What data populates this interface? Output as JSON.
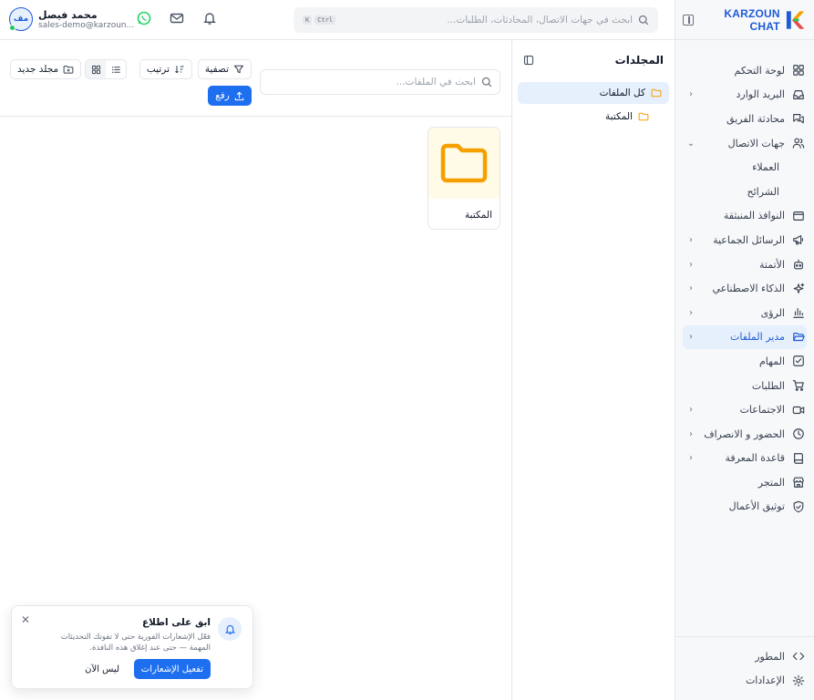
{
  "brand": {
    "name": "KARZOUN CHAT"
  },
  "sidebar": {
    "items": [
      {
        "label": "لوحة التحكم",
        "icon": "dashboard-icon",
        "chevron": false
      },
      {
        "label": "البريد الوارد",
        "icon": "inbox-icon",
        "chevron": true
      },
      {
        "label": "محادثة الفريق",
        "icon": "team-chat-icon",
        "chevron": false
      },
      {
        "label": "جهات الاتصال",
        "icon": "contacts-icon",
        "chevron": true,
        "expanded": true
      },
      {
        "label": "العملاء",
        "sub": true
      },
      {
        "label": "الشرائح",
        "sub": true
      },
      {
        "label": "النوافذ المنبثقة",
        "icon": "popup-icon",
        "chevron": false
      },
      {
        "label": "الرسائل الجماعية",
        "icon": "megaphone-icon",
        "chevron": true
      },
      {
        "label": "الأتمتة",
        "icon": "bot-icon",
        "chevron": true
      },
      {
        "label": "الذكاء الاصطناعي",
        "icon": "sparkles-icon",
        "chevron": true
      },
      {
        "label": "الرؤى",
        "icon": "chart-icon",
        "chevron": true
      },
      {
        "label": "مدير الملفات",
        "icon": "folder-open-icon",
        "chevron": true,
        "active": true
      },
      {
        "label": "المهام",
        "icon": "tasks-icon",
        "chevron": false
      },
      {
        "label": "الطلبات",
        "icon": "cart-icon",
        "chevron": false
      },
      {
        "label": "الاجتماعات",
        "icon": "video-icon",
        "chevron": true
      },
      {
        "label": "الحضور و الانصراف",
        "icon": "clock-icon",
        "chevron": true
      },
      {
        "label": "قاعدة المعرفة",
        "icon": "book-icon",
        "chevron": true
      },
      {
        "label": "المتجر",
        "icon": "store-icon",
        "chevron": false
      },
      {
        "label": "توثيق الأعمال",
        "icon": "shield-check-icon",
        "chevron": false
      }
    ],
    "bottom": [
      {
        "label": "المطور",
        "icon": "code-icon"
      },
      {
        "label": "الإعدادات",
        "icon": "gear-icon"
      }
    ]
  },
  "header": {
    "search_placeholder": "ابحث في جهات الاتصال، المحادثات، الطلبات...",
    "kbd": [
      "Ctrl",
      "K"
    ],
    "user_name": "محمد فيصل",
    "user_email": "sales-demo@karzoun...",
    "avatar_initials": "مف"
  },
  "folders": {
    "title": "المجلدات",
    "items": [
      {
        "label": "كل الملفات",
        "active": true
      },
      {
        "label": "المكتبة",
        "sub": true
      }
    ]
  },
  "toolbar": {
    "search_placeholder": "ابحث في الملفات...",
    "filter_label": "تصفية",
    "sort_label": "ترتيب",
    "new_folder_label": "مجلد جديد",
    "upload_label": "رفع"
  },
  "files": [
    {
      "name": "المكتبة",
      "type": "folder"
    }
  ],
  "toast": {
    "title": "ابق على اطلاع",
    "body": "فعّل الإشعارات الفورية حتى لا تفوتك التحديثات المهمة — حتى عند إغلاق هذه النافذة.",
    "primary": "تفعيل الإشعارات",
    "secondary": "ليس الآن"
  },
  "colors": {
    "accent": "#1e6ff0",
    "active_bg": "#e6effc",
    "folder": "#f5a000",
    "whatsapp": "#25d366"
  }
}
